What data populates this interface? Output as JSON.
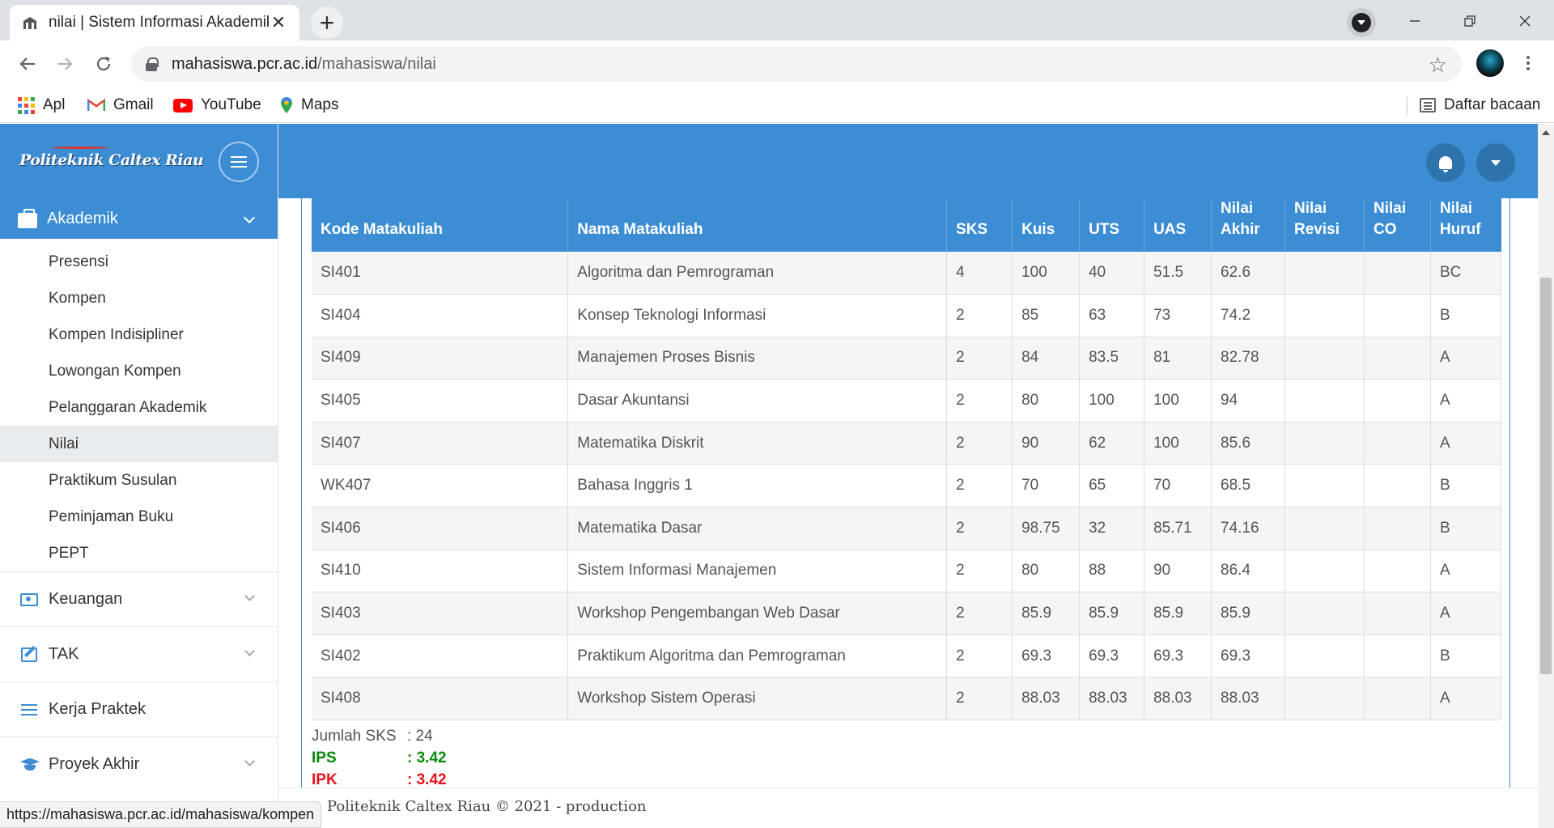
{
  "browser": {
    "tab_title": "nilai | Sistem Informasi Akademik",
    "tab_close": "✕",
    "new_tab": "+",
    "url_host": "mahasiswa.pcr.ac.id",
    "url_path": "/mahasiswa/nilai",
    "bookmarks": {
      "apps": "Apl",
      "gmail": "Gmail",
      "youtube": "YouTube",
      "maps": "Maps",
      "reading_list": "Daftar bacaan"
    },
    "status_url": "https://mahasiswa.pcr.ac.id/mahasiswa/kompen"
  },
  "sidebar": {
    "logo": "Politeknik Caltex Riau",
    "active_menu": "Akademik",
    "submenu": [
      "Presensi",
      "Kompen",
      "Kompen Indisipliner",
      "Lowongan Kompen",
      "Pelanggaran Akademik",
      "Nilai",
      "Praktikum Susulan",
      "Peminjaman Buku",
      "PEPT"
    ],
    "active_submenu": "Nilai",
    "groups": [
      "Keuangan",
      "TAK",
      "Kerja Praktek",
      "Proyek Akhir"
    ]
  },
  "table": {
    "headers": [
      [
        "Kode Matakuliah"
      ],
      [
        "Nama Matakuliah"
      ],
      [
        "SKS"
      ],
      [
        "Kuis"
      ],
      [
        "UTS"
      ],
      [
        "UAS"
      ],
      [
        "Nilai",
        "Akhir"
      ],
      [
        "Nilai",
        "Revisi"
      ],
      [
        "Nilai",
        "CO"
      ],
      [
        "Nilai",
        "Huruf"
      ]
    ],
    "rows": [
      [
        "SI401",
        "Algoritma dan Pemrograman",
        "4",
        "100",
        "40",
        "51.5",
        "62.6",
        "",
        "",
        "BC"
      ],
      [
        "SI404",
        "Konsep Teknologi Informasi",
        "2",
        "85",
        "63",
        "73",
        "74.2",
        "",
        "",
        "B"
      ],
      [
        "SI409",
        "Manajemen Proses Bisnis",
        "2",
        "84",
        "83.5",
        "81",
        "82.78",
        "",
        "",
        "A"
      ],
      [
        "SI405",
        "Dasar Akuntansi",
        "2",
        "80",
        "100",
        "100",
        "94",
        "",
        "",
        "A"
      ],
      [
        "SI407",
        "Matematika Diskrit",
        "2",
        "90",
        "62",
        "100",
        "85.6",
        "",
        "",
        "A"
      ],
      [
        "WK407",
        "Bahasa Inggris 1",
        "2",
        "70",
        "65",
        "70",
        "68.5",
        "",
        "",
        "B"
      ],
      [
        "SI406",
        "Matematika Dasar",
        "2",
        "98.75",
        "32",
        "85.71",
        "74.16",
        "",
        "",
        "B"
      ],
      [
        "SI410",
        "Sistem Informasi Manajemen",
        "2",
        "80",
        "88",
        "90",
        "86.4",
        "",
        "",
        "A"
      ],
      [
        "SI403",
        "Workshop Pengembangan Web Dasar",
        "2",
        "85.9",
        "85.9",
        "85.9",
        "85.9",
        "",
        "",
        "A"
      ],
      [
        "SI402",
        "Praktikum Algoritma dan Pemrograman",
        "2",
        "69.3",
        "69.3",
        "69.3",
        "69.3",
        "",
        "",
        "B"
      ],
      [
        "SI408",
        "Workshop Sistem Operasi",
        "2",
        "88.03",
        "88.03",
        "88.03",
        "88.03",
        "",
        "",
        "A"
      ]
    ]
  },
  "summary": {
    "sks_label": "Jumlah SKS",
    "sks_value": ": 24",
    "ips_label": "IPS",
    "ips_value": ": 3.42",
    "ipk_label": "IPK",
    "ipk_value": ": 3.42"
  },
  "footer": "Politeknik Caltex Riau © 2021 - production",
  "colors": {
    "brand_blue": "#3c8dd4",
    "ips_green": "#0a8a0a",
    "ipk_red": "#e0151b"
  }
}
